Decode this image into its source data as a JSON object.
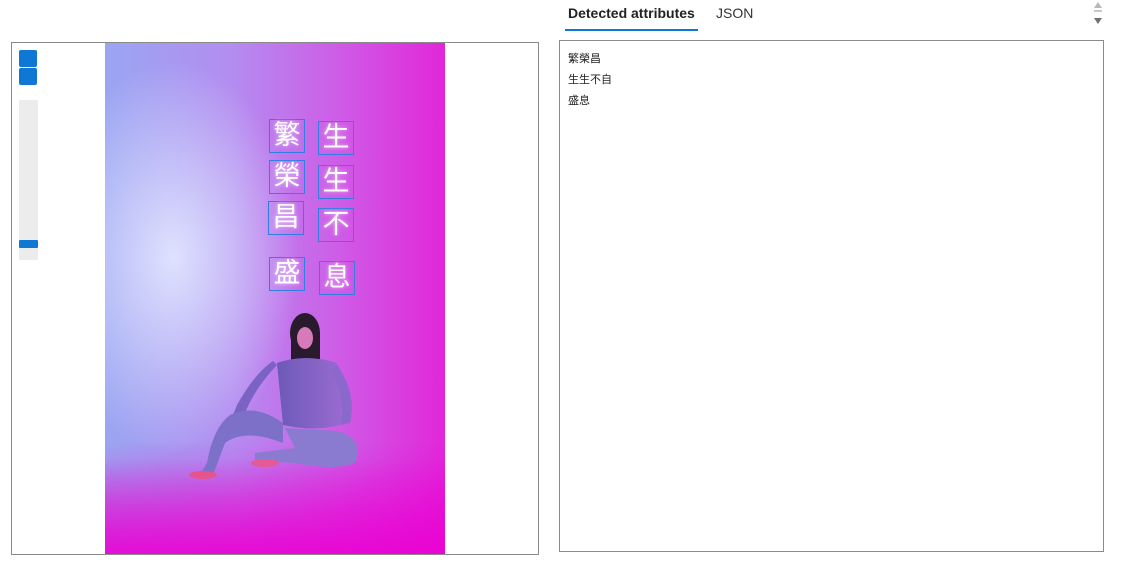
{
  "tabs": [
    {
      "label": "Detected attributes",
      "active": true
    },
    {
      "label": "JSON",
      "active": false
    }
  ],
  "viewer": {
    "zoom_in_icon": "zoom-in-icon",
    "zoom_out_icon": "zoom-out-icon",
    "zoom_level_fraction": 0.92,
    "detected_glyphs": [
      "繁",
      "生",
      "榮",
      "生",
      "昌",
      "不",
      "盛",
      "息"
    ]
  },
  "results": {
    "lines": [
      "繁榮昌",
      "生生不自",
      "盛息"
    ]
  },
  "colors": {
    "accent": "#0f78d4",
    "bbox": "#2f7fe0"
  }
}
